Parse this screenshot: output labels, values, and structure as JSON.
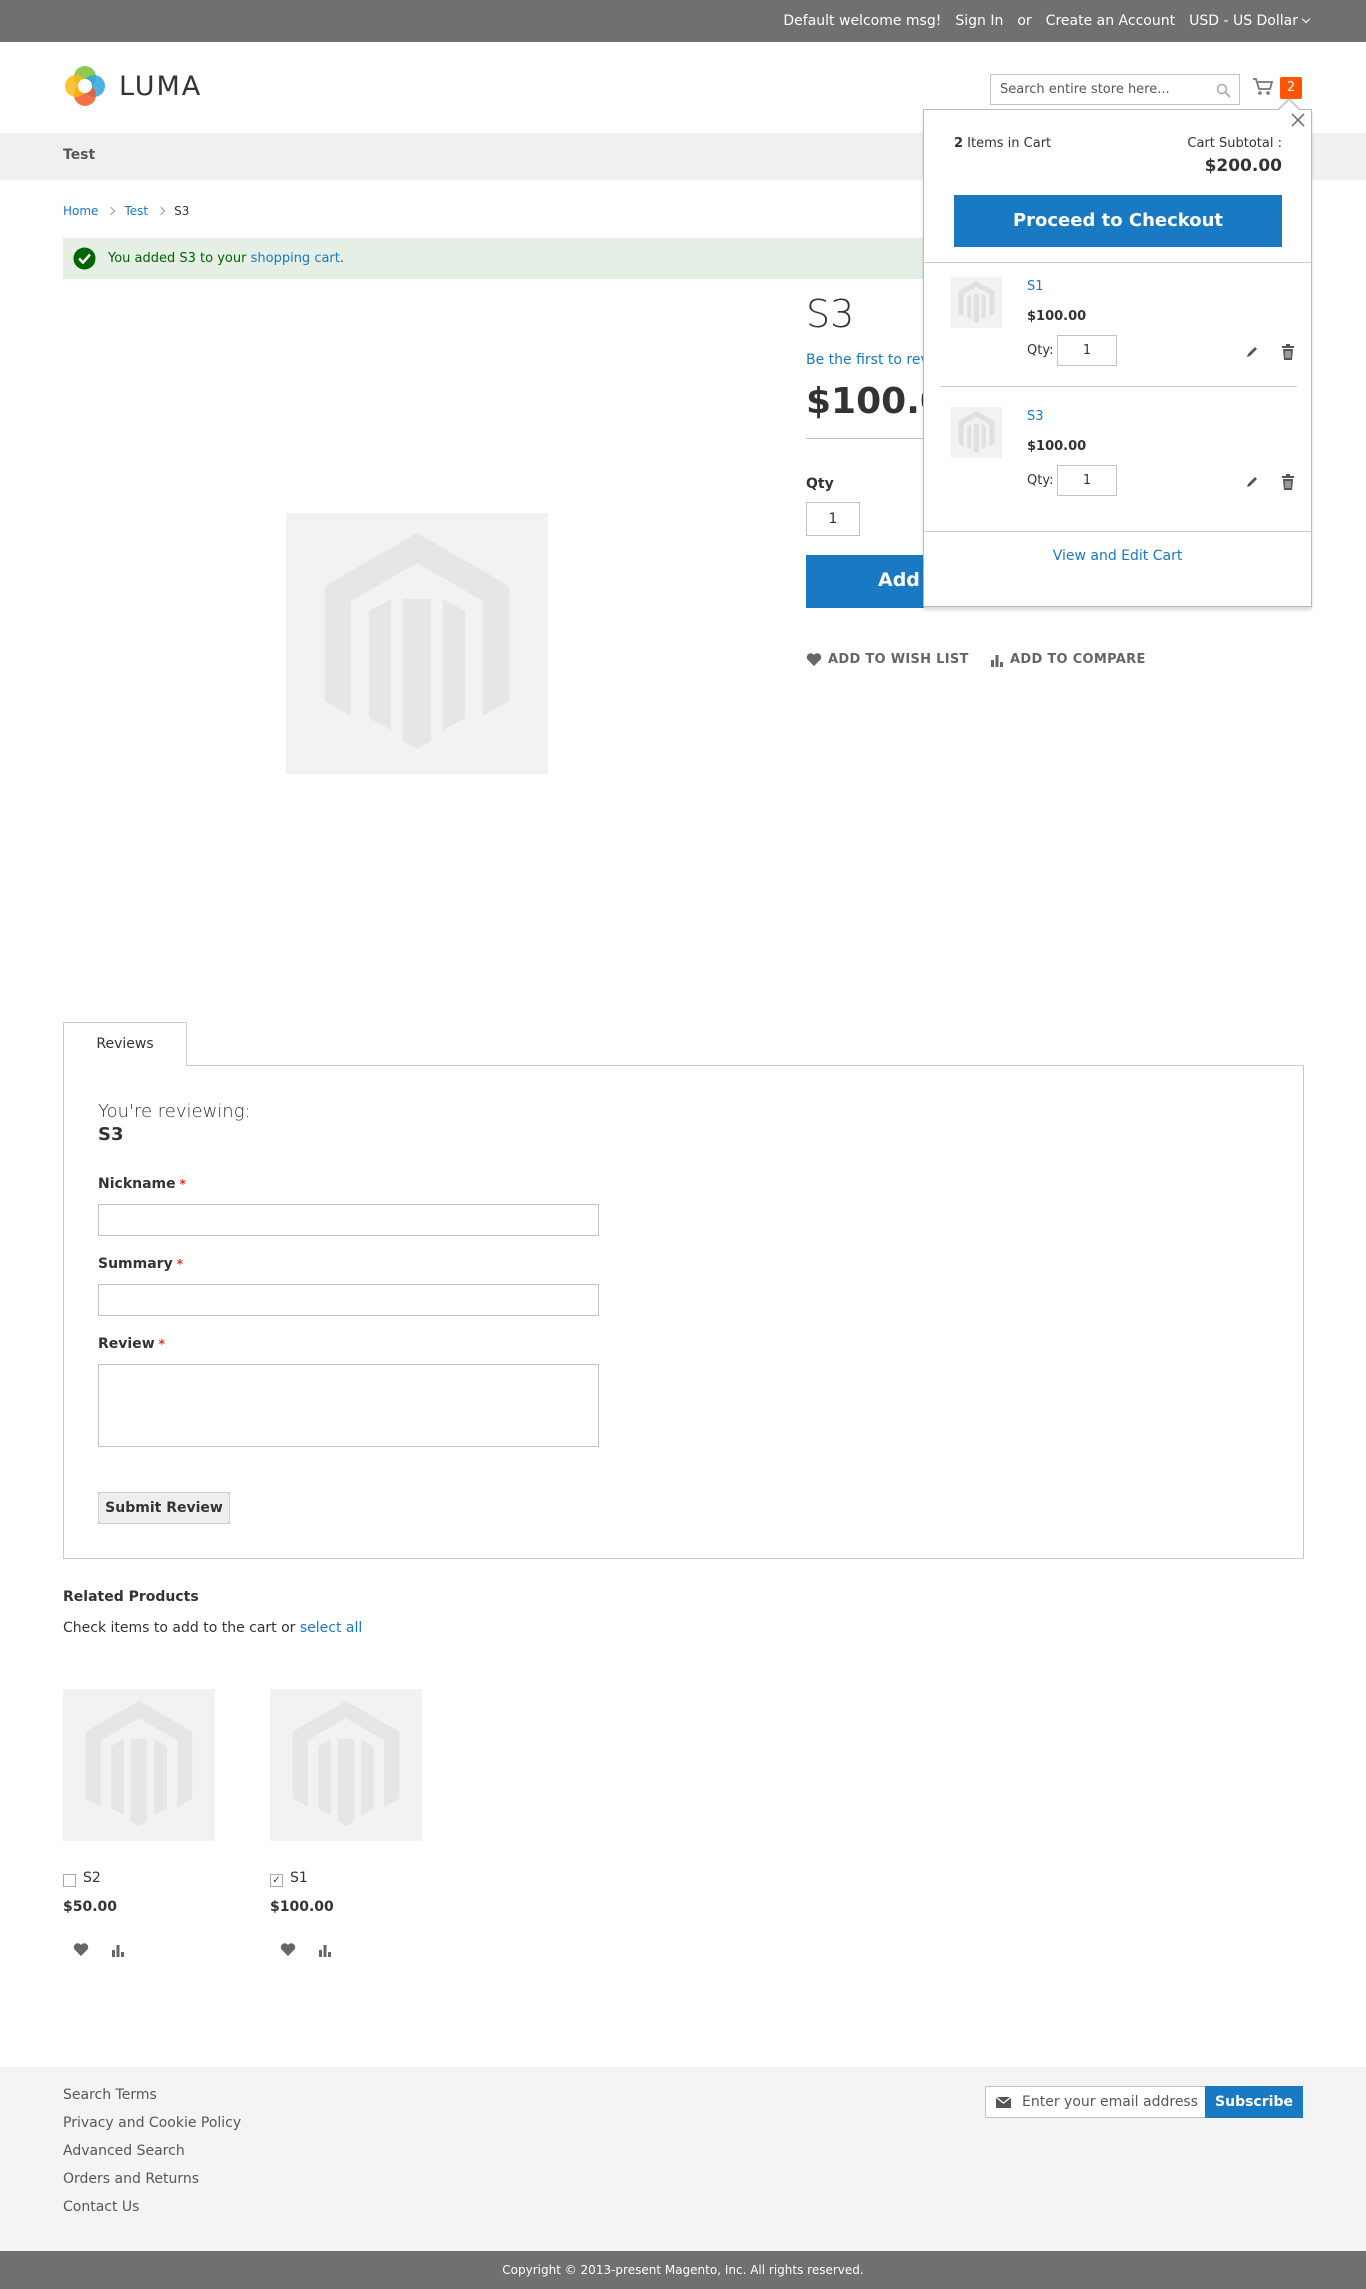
{
  "topbar": {
    "welcome": "Default welcome msg!",
    "sign_in": "Sign In",
    "or": "or",
    "create_account": "Create an Account",
    "currency": "USD - US Dollar"
  },
  "header": {
    "logo_text": "LUMA",
    "search_placeholder": "Search entire store here...",
    "cart_count": "2"
  },
  "nav": {
    "items": [
      {
        "label": "Test"
      }
    ]
  },
  "breadcrumbs": [
    {
      "label": "Home"
    },
    {
      "label": "Test"
    },
    {
      "label": "S3"
    }
  ],
  "message": {
    "text_before": "You added S3 to your ",
    "link": "shopping cart",
    "text_after": "."
  },
  "product": {
    "name": "S3",
    "review_link": "Be the first to review this product",
    "price": "$100.00",
    "qty_label": "Qty",
    "qty": "1",
    "add_to_cart": "Add to Cart",
    "wishlist": "ADD TO WISH LIST",
    "compare": "ADD TO COMPARE"
  },
  "minicart": {
    "count_number": "2",
    "count_text": " Items in Cart",
    "subtotal_label": "Cart Subtotal :",
    "subtotal": "$200.00",
    "checkout": "Proceed to Checkout",
    "items": [
      {
        "name": "S1",
        "price": "$100.00",
        "qty_label": "Qty:",
        "qty": "1"
      },
      {
        "name": "S3",
        "price": "$100.00",
        "qty_label": "Qty:",
        "qty": "1"
      }
    ],
    "view_cart": "View and Edit Cart"
  },
  "tabs": [
    {
      "label": "Reviews"
    }
  ],
  "review_form": {
    "reviewing_label": "You're reviewing:",
    "product_name": "S3",
    "nickname_label": "Nickname",
    "summary_label": "Summary",
    "review_label": "Review",
    "required_mark": "*",
    "submit": "Submit Review"
  },
  "related": {
    "title": "Related Products",
    "desc_before": "Check items to add to the cart or ",
    "select_all": "select all",
    "items": [
      {
        "name": "S2",
        "price": "$50.00",
        "checked": false
      },
      {
        "name": "S1",
        "price": "$100.00",
        "checked": true
      }
    ]
  },
  "footer": {
    "links": [
      "Search Terms",
      "Privacy and Cookie Policy",
      "Advanced Search",
      "Orders and Returns",
      "Contact Us"
    ],
    "newsletter_placeholder": "Enter your email address",
    "subscribe": "Subscribe",
    "copyright": "Copyright © 2013-present Magento, Inc. All rights reserved."
  },
  "colors": {
    "primary_blue": "#1979c3",
    "top_bar": "#6e716e",
    "cart_badge": "#ff5501",
    "success_bg": "#e5efe5",
    "required": "#e02b27"
  },
  "icons": [
    "luma-logo-icon",
    "search-icon",
    "cart-icon",
    "check-circle-icon",
    "heart-icon",
    "bar-chart-icon",
    "close-icon",
    "pencil-icon",
    "trash-icon",
    "envelope-icon",
    "magento-placeholder-icon"
  ]
}
